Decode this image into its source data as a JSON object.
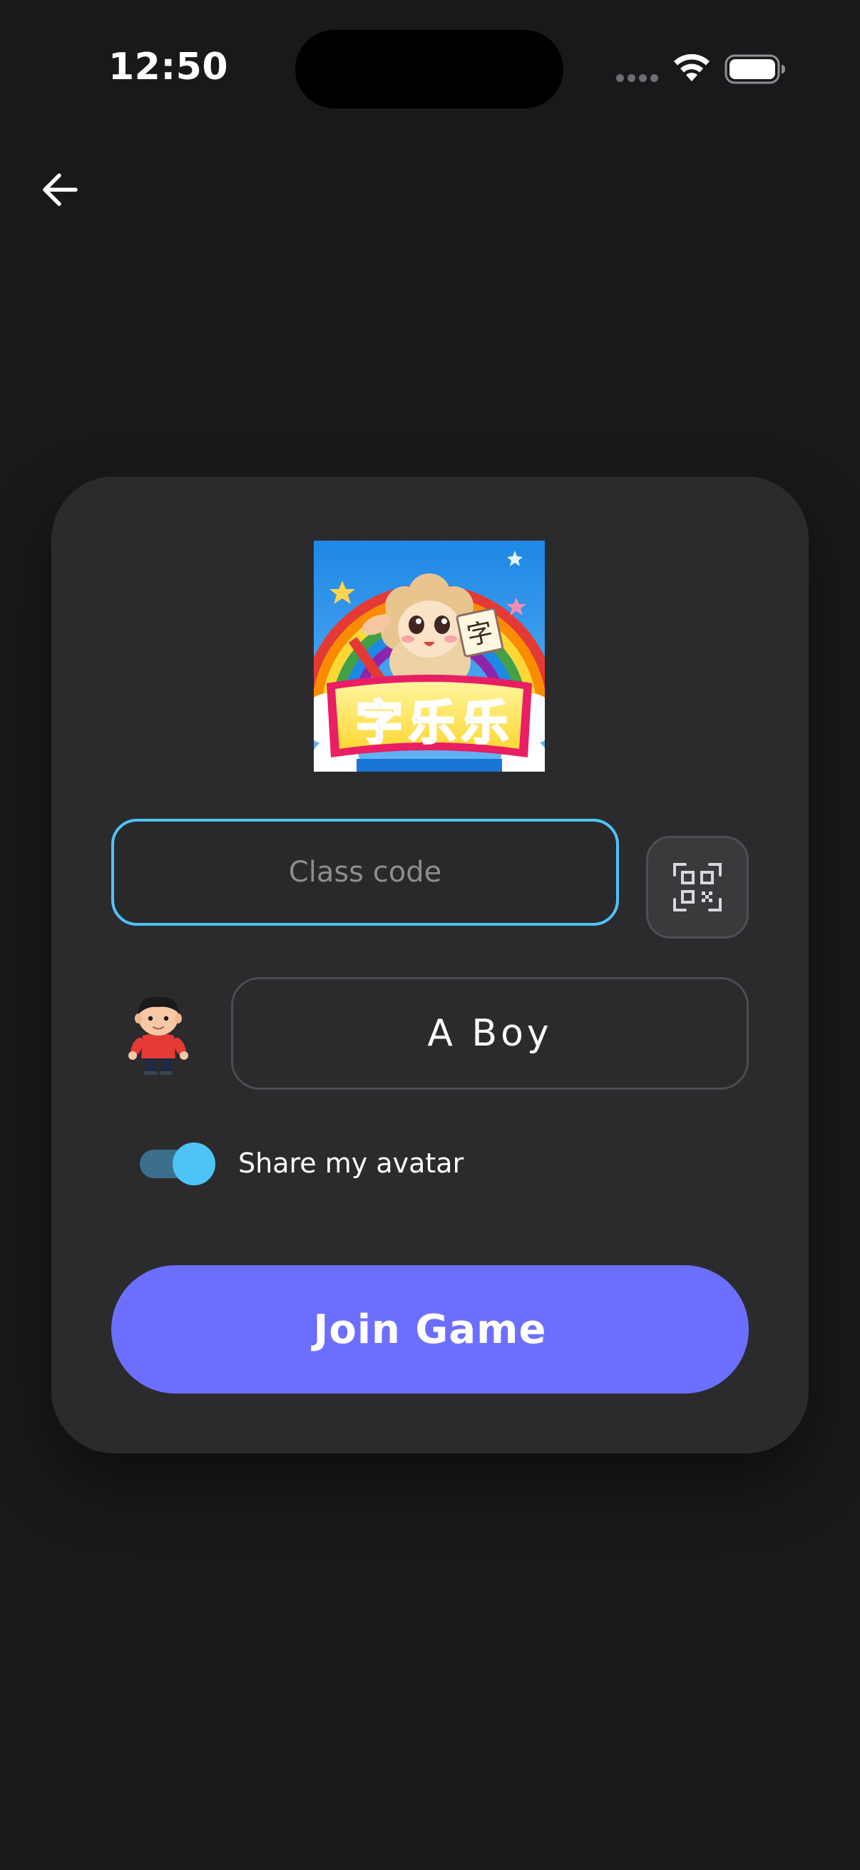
{
  "status_bar": {
    "time": "12:50"
  },
  "nav": {
    "back_icon": "arrow-left-icon"
  },
  "logo": {
    "text_chars": [
      "字",
      "乐",
      "乐"
    ],
    "badge_char": "字"
  },
  "class_code": {
    "placeholder": "Class code",
    "value": ""
  },
  "qr_scan": {
    "icon": "qr-code-scan-icon"
  },
  "player": {
    "avatar": "boy-avatar",
    "name": "A Boy"
  },
  "share_avatar": {
    "label": "Share my avatar",
    "enabled": true
  },
  "join": {
    "label": "Join Game"
  },
  "colors": {
    "background": "#19191b",
    "card": "#2b2b2d",
    "accent_blue": "#4fc3f7",
    "join_button": "#6c6ffd"
  }
}
